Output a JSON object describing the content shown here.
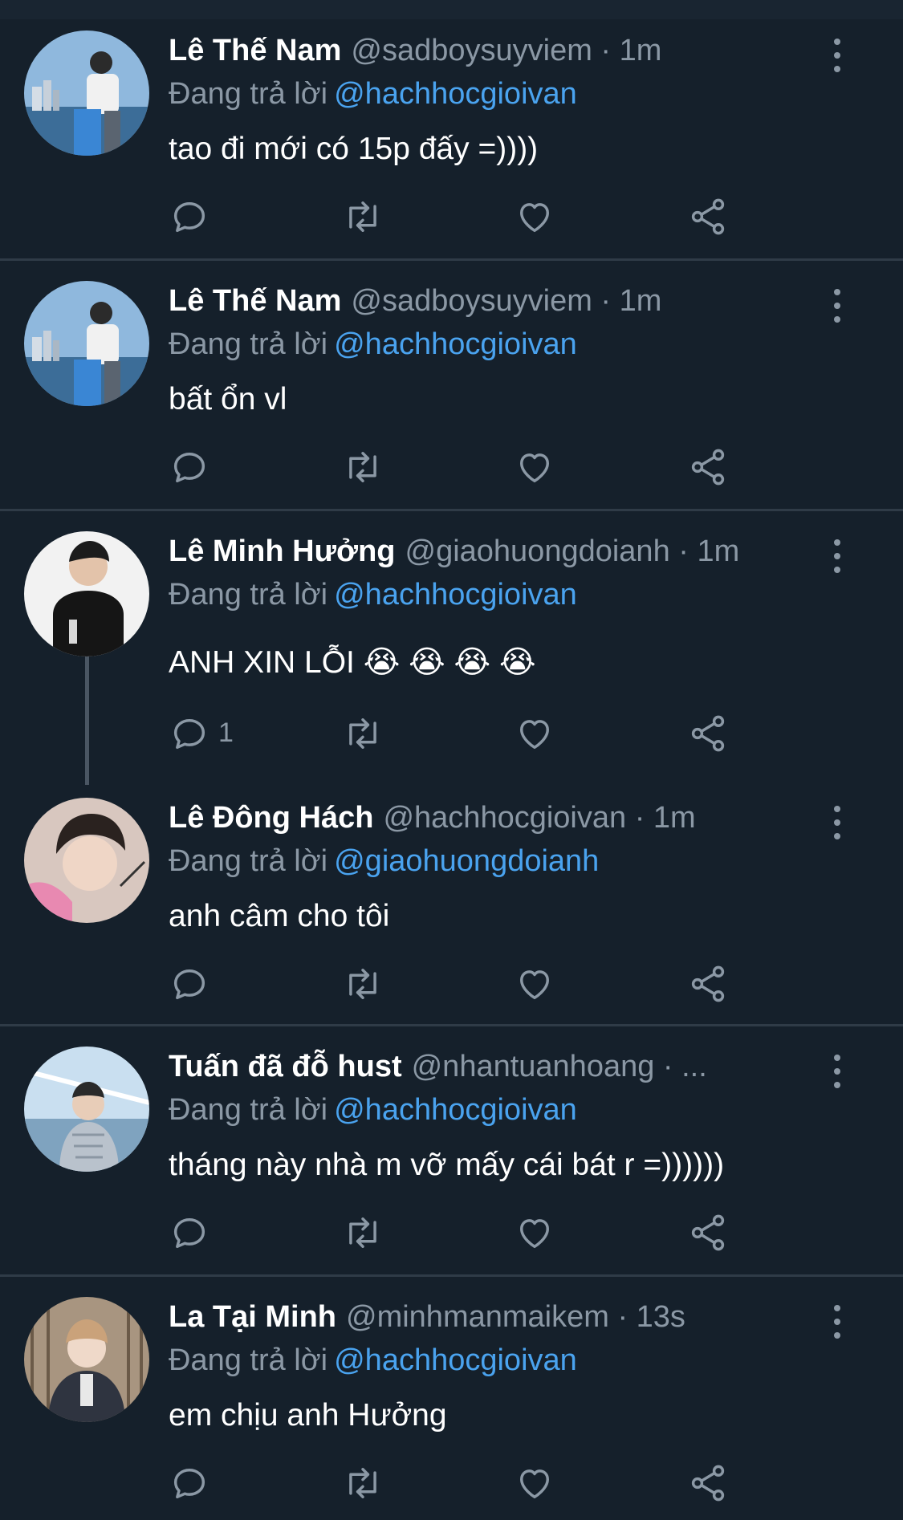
{
  "tweets": [
    {
      "name": "Lê Thế Nam",
      "handle": "@sadboysuyviem · 1m",
      "reply_prefix": "Đang trả lời",
      "reply_to": "@hachhocgioivan",
      "text": "tao đi mới có 15p đấy =))))",
      "reply_count": ""
    },
    {
      "name": "Lê Thế Nam",
      "handle": "@sadboysuyviem · 1m",
      "reply_prefix": "Đang trả lời",
      "reply_to": "@hachhocgioivan",
      "text": "bất ổn vl",
      "reply_count": ""
    },
    {
      "name": "Lê Minh Hưởng",
      "handle": "@giaohuongdoianh · 1m",
      "reply_prefix": "Đang trả lời",
      "reply_to": "@hachhocgioivan",
      "text": "ANH XIN LỖI 😭 😭 😭 😭",
      "reply_count": "1"
    },
    {
      "name": "Lê Đông Hách",
      "handle": "@hachhocgioivan · 1m",
      "reply_prefix": "Đang trả lời",
      "reply_to": "@giaohuongdoianh",
      "text": "anh câm cho tôi",
      "reply_count": ""
    },
    {
      "name": "Tuấn đã đỗ hust",
      "handle": "@nhantuanhoang · ...",
      "reply_prefix": "Đang trả lời",
      "reply_to": "@hachhocgioivan",
      "text": "tháng này nhà m vỡ mấy cái bát r =))))))",
      "reply_count": ""
    },
    {
      "name": "La Tại Minh",
      "handle": "@minhmanmaikem · 13s",
      "reply_prefix": "Đang trả lời",
      "reply_to": "@hachhocgioivan",
      "text": "em chịu anh Hưởng",
      "reply_count": ""
    }
  ],
  "icons": {
    "reply": "reply-icon",
    "retweet": "retweet-icon",
    "like": "like-icon",
    "share": "share-icon",
    "more": "more-options-icon"
  },
  "colors": {
    "background": "#15202b",
    "secondary_text": "#8b98a5",
    "mention": "#4aa3ef",
    "divider": "#2f3b47"
  }
}
